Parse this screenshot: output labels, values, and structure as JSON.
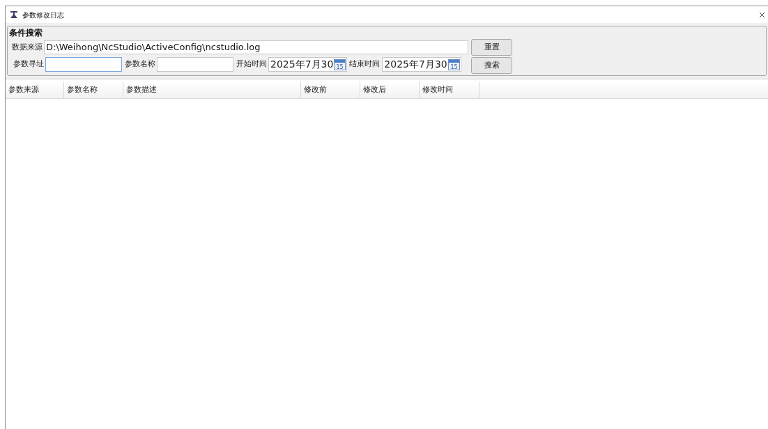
{
  "window": {
    "title": "参数修改日志"
  },
  "search_group": {
    "title": "条件搜索",
    "source_label": "数据来源",
    "source_value": "D:\\Weihong\\NcStudio\\ActiveConfig\\ncstudio.log",
    "reset_button": "重置",
    "address_label": "参数寻址",
    "name_label": "参数名称",
    "start_label": "开始时间",
    "start_value": "2025年7月30",
    "start_calendar_day": "15",
    "end_label": "结束时间",
    "end_value": "2025年7月30",
    "end_calendar_day": "15",
    "search_button": "搜索"
  },
  "table": {
    "columns": [
      "参数来源",
      "参数名称",
      "参数描述",
      "修改前",
      "修改后",
      "修改时间"
    ]
  }
}
